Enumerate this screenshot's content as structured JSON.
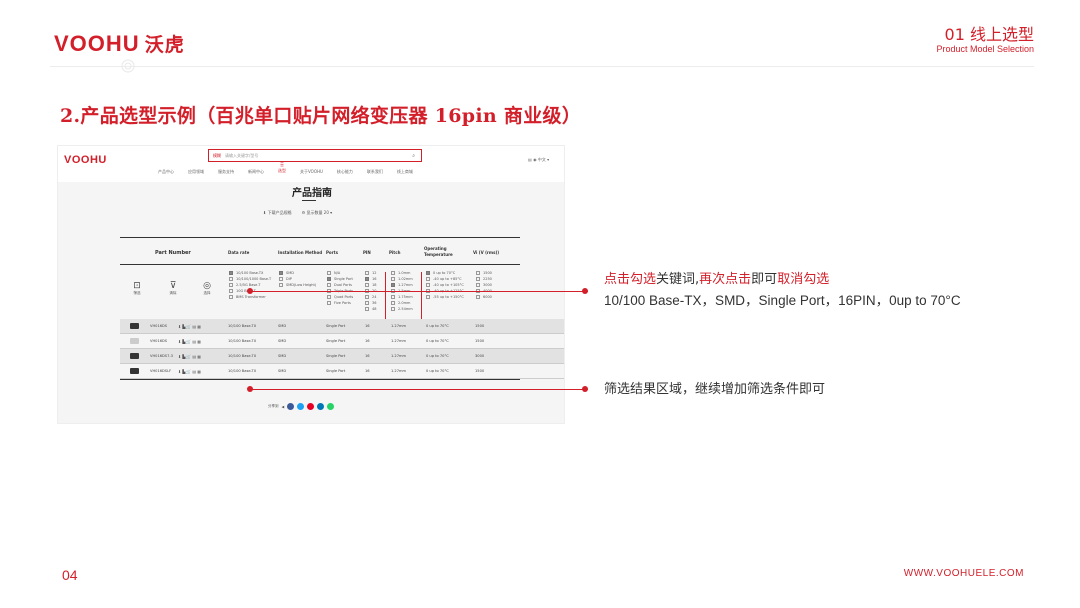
{
  "header": {
    "logo_text": "VOOHU",
    "logo_cn": "沃虎",
    "section_number": "01 线上选型",
    "section_en": "Product Model Selection"
  },
  "slide_title": "2.产品选型示例（百兆单口贴片网络变压器 16pin 商业级）",
  "screenshot": {
    "logo": "VOOHU",
    "search_tag": "模糊",
    "search_placeholder": "请输入关键字/型号",
    "lang": "中文",
    "nav": [
      "产品中心",
      "应用领域",
      "服务支持",
      "新闻中心",
      "关于VOOHU",
      "核心能力",
      "联系我们",
      "线上商城"
    ],
    "nav_grid_label": "选型",
    "page_title": "产品指南",
    "actions": [
      "下载产品规格",
      "显示数量 20"
    ],
    "columns": [
      "Part Number",
      "Data rate",
      "Installation Method",
      "Ports",
      "PIN",
      "Pitch",
      "Operating Temperature",
      "Vi (V (rms))"
    ],
    "side_buttons": [
      "筛选",
      "清除",
      "选择"
    ],
    "filters": {
      "data_rate": [
        "10/100 Base-TX",
        "10/100/1000 Base-T",
        "2.5/5G Base-T",
        "10G Base-T",
        "BMS Transformer"
      ],
      "installation": [
        "SMD",
        "DIP",
        "SMD(Low Height)"
      ],
      "ports": [
        "N/A",
        "Single Port",
        "Dual Ports",
        "Triple Ports",
        "Quad Ports",
        "Five Ports"
      ],
      "pin": [
        "12",
        "16",
        "18",
        "20",
        "24",
        "36",
        "48",
        "54"
      ],
      "pitch": [
        "1.0mm",
        "1.02mm",
        "1.27mm",
        "1.5mm",
        "1.75mm",
        "2.0mm",
        "2.54mm"
      ],
      "temperature": [
        "0 up to 70°C",
        "-40 up to +85°C",
        "-40 up to +105°C",
        "-40 up to +125°C",
        "-55 up to +150°C"
      ],
      "vi": [
        "1500",
        "2250",
        "3000",
        "4000",
        "6000"
      ]
    },
    "rows": [
      {
        "part": "VH016DS",
        "rate": "10/100 Base-TX",
        "mount": "SMD",
        "ports": "Single Port",
        "pin": "16",
        "pitch": "1.27mm",
        "temp": "0 up to 70°C",
        "vi": "1500"
      },
      {
        "part": "VH016DS",
        "rate": "10/100 Base-TX",
        "mount": "SMD",
        "ports": "Single Port",
        "pin": "16",
        "pitch": "1.27mm",
        "temp": "0 up to 70°C",
        "vi": "1500"
      },
      {
        "part": "VH016DS7-3",
        "rate": "10/100 Base-TX",
        "mount": "SMD",
        "ports": "Single Port",
        "pin": "16",
        "pitch": "1.27mm",
        "temp": "0 up to 70°C",
        "vi": "3000"
      },
      {
        "part": "VH016DSLF",
        "rate": "10/100 Base-TX",
        "mount": "SMD",
        "ports": "Single Port",
        "pin": "16",
        "pitch": "1.27mm",
        "temp": "0 up to 70°C",
        "vi": "1500"
      }
    ],
    "share_label": "分享到"
  },
  "callouts": {
    "c1_part1": "点击勾选",
    "c1_part2": "关键词,",
    "c1_part3": "再次点击",
    "c1_part4": "即可",
    "c1_part5": "取消勾选",
    "c1_values": "10/100 Base-TX，SMD，Single Port，16PIN，0up to 70°C",
    "c2": "筛选结果区域，继续增加筛选条件即可"
  },
  "footer": {
    "page_number": "04",
    "url": "WWW.VOOHUELE.COM"
  },
  "colors": {
    "brand": "#d31f2a"
  }
}
